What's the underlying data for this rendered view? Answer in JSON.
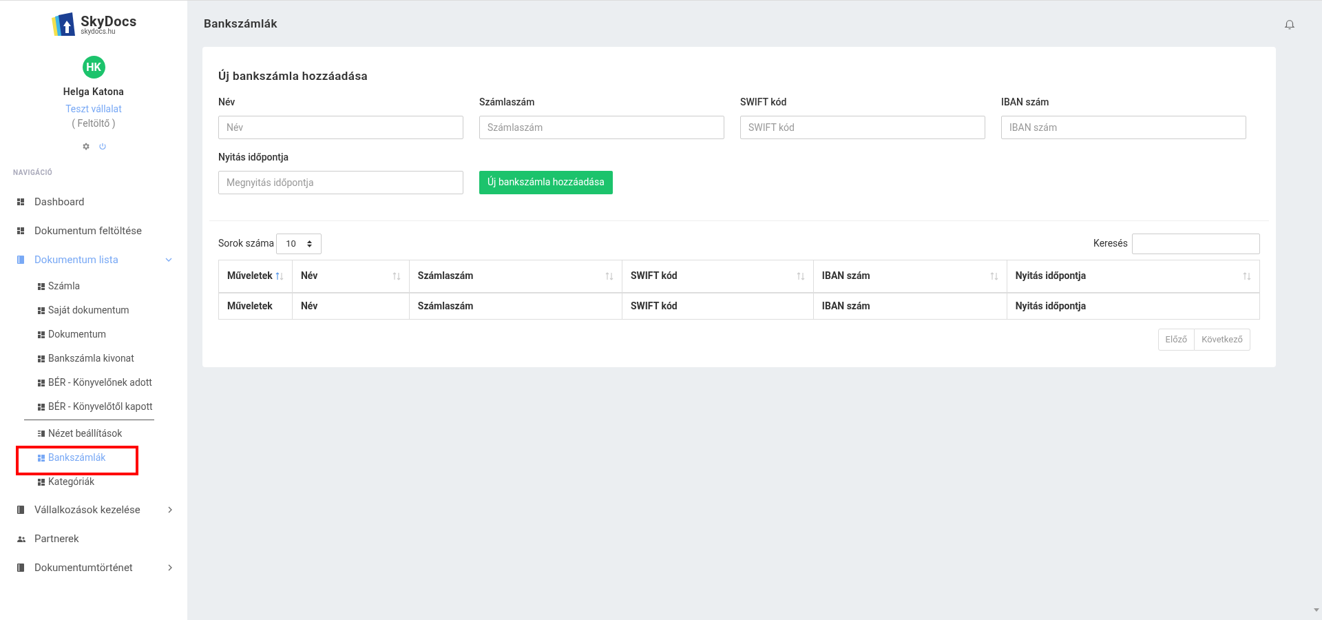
{
  "brand": {
    "name": "SkyDocs",
    "domain": "skydocs.hu"
  },
  "user": {
    "initials": "HK",
    "name": "Helga Katona",
    "company": "Teszt vállalat",
    "role": "( Feltöltő )"
  },
  "sidebar": {
    "heading": "NAVIGÁCIÓ",
    "items": [
      {
        "label": "Dashboard",
        "kind": "grid",
        "selected": false
      },
      {
        "label": "Dokumentum feltöltése",
        "kind": "grid",
        "selected": false
      },
      {
        "label": "Dokumentum lista",
        "kind": "book",
        "selected": true,
        "expanded": true,
        "children": [
          {
            "label": "Számla",
            "kind": "grid",
            "selected": false
          },
          {
            "label": "Saját dokumentum",
            "kind": "grid",
            "selected": false
          },
          {
            "label": "Dokumentum",
            "kind": "grid",
            "selected": false
          },
          {
            "label": "Bankszámla kivonat",
            "kind": "grid",
            "selected": false
          },
          {
            "label": "BÉR - Könyvelőnek adott",
            "kind": "grid",
            "selected": false
          },
          {
            "label": "BÉR - Könyvelőtől kapott",
            "kind": "grid",
            "selected": false
          },
          {
            "label": "Nézet beállítások",
            "kind": "list",
            "selected": false,
            "divider_before": true
          },
          {
            "label": "Bankszámlák",
            "kind": "grid",
            "selected": true,
            "highlighted": true
          },
          {
            "label": "Kategóriák",
            "kind": "grid",
            "selected": false
          }
        ]
      },
      {
        "label": "Vállalkozások kezelése",
        "kind": "book",
        "selected": false,
        "expanded": false
      },
      {
        "label": "Partnerek",
        "kind": "people",
        "selected": false
      },
      {
        "label": "Dokumentumtörténet",
        "kind": "book",
        "selected": false,
        "expanded": false
      }
    ]
  },
  "page_title": "Bankszámlák",
  "form": {
    "title": "Új bankszámla hozzáadása",
    "fields": [
      {
        "label": "Név",
        "placeholder": "Név"
      },
      {
        "label": "Számlaszám",
        "placeholder": "Számlaszám"
      },
      {
        "label": "SWIFT kód",
        "placeholder": "SWIFT kód"
      },
      {
        "label": "IBAN szám",
        "placeholder": "IBAN szám"
      },
      {
        "label": "Nyitás időpontja",
        "placeholder": "Megnyitás időpontja"
      }
    ],
    "submit": "Új bankszámla hozzáadása"
  },
  "table": {
    "rows_label": "Sorok száma",
    "rows_value": "10",
    "search_label": "Keresés",
    "columns": [
      {
        "label": "Műveletek",
        "sorted": true
      },
      {
        "label": "Név",
        "sorted": false
      },
      {
        "label": "Számlaszám",
        "sorted": false
      },
      {
        "label": "SWIFT kód",
        "sorted": false
      },
      {
        "label": "IBAN szám",
        "sorted": false
      },
      {
        "label": "Nyitás időpontja",
        "sorted": false
      }
    ],
    "footer": [
      "Műveletek",
      "Név",
      "Számlaszám",
      "SWIFT kód",
      "IBAN szám",
      "Nyitás időpontja"
    ],
    "pagination": [
      {
        "label": "Előző",
        "disabled": true
      },
      {
        "label": "Következő",
        "disabled": true
      }
    ]
  }
}
